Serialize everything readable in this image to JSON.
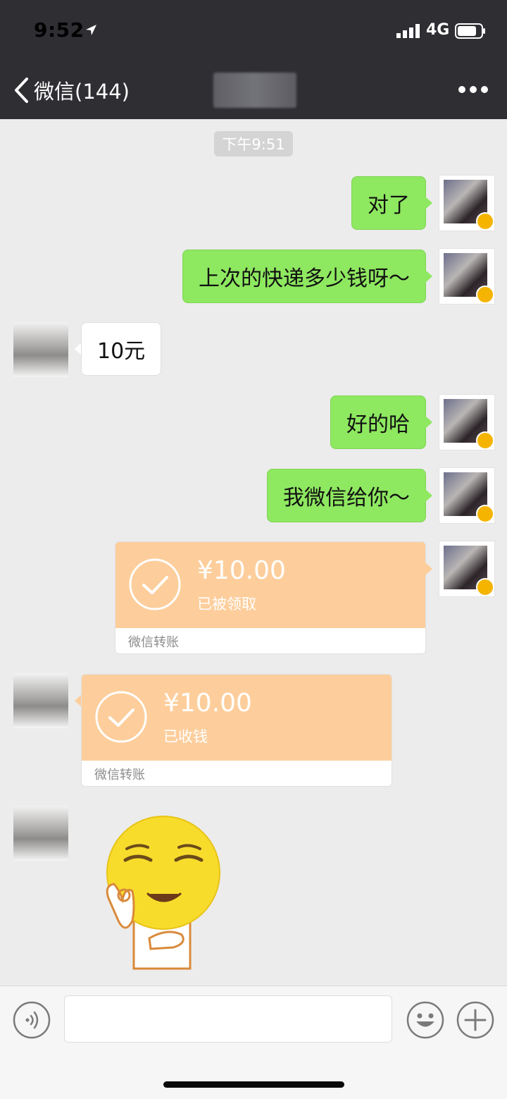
{
  "status_bar": {
    "time": "9:52",
    "network": "4G"
  },
  "nav": {
    "back_label": "微信(144)"
  },
  "chat": {
    "timestamp": "下午9:51",
    "messages": [
      {
        "from": "me",
        "text": "对了"
      },
      {
        "from": "me",
        "text": "上次的快递多少钱呀～"
      },
      {
        "from": "other",
        "text": "10元"
      },
      {
        "from": "me",
        "text": "好的哈"
      },
      {
        "from": "me",
        "text": "我微信给你～"
      }
    ],
    "transfers": [
      {
        "from": "me",
        "amount": "¥10.00",
        "status": "已被领取",
        "brand": "微信转账"
      },
      {
        "from": "other",
        "amount": "¥10.00",
        "status": "已收钱",
        "brand": "微信转账"
      }
    ]
  },
  "colors": {
    "header": "#2e2e33",
    "me_bubble": "#8ee860",
    "transfer": "#fdce9c",
    "background": "#ececec"
  }
}
